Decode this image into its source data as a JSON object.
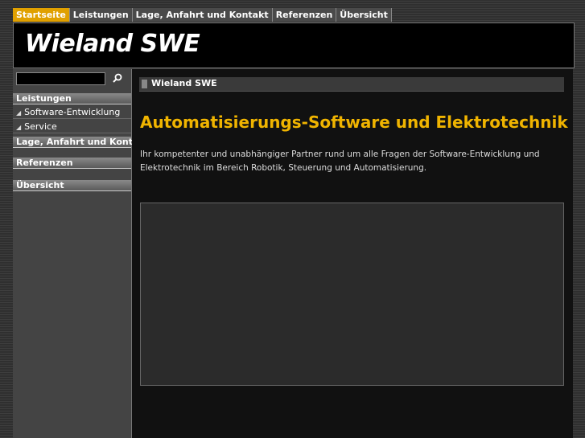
{
  "nav": {
    "tabs": [
      {
        "label": "Startseite",
        "active": true
      },
      {
        "label": "Leistungen",
        "active": false
      },
      {
        "label": "Lage, Anfahrt und Kontakt",
        "active": false
      },
      {
        "label": "Referenzen",
        "active": false
      },
      {
        "label": "Übersicht",
        "active": false
      }
    ]
  },
  "header": {
    "logo": "Wieland SWE"
  },
  "sidebar": {
    "search": {
      "value": "",
      "placeholder": ""
    },
    "sections": [
      {
        "label": "Leistungen"
      },
      {
        "label": "Lage, Anfahrt und Kontakt"
      },
      {
        "label": "Referenzen"
      },
      {
        "label": "Übersicht"
      }
    ],
    "subitems": [
      {
        "label": "Software-Entwicklung"
      },
      {
        "label": "Service"
      }
    ]
  },
  "main": {
    "breadcrumb": "Wieland SWE",
    "heading": "Automatisierungs-Software und Elektrotechnik",
    "paragraph_line1": "Ihr kompetenter und unabhängiger Partner rund um alle Fragen der Software-Entwicklung und",
    "paragraph_line2": "Elektrotechnik im Bereich Robotik, Steuerung und Automatisierung."
  },
  "colors": {
    "accent": "#e0a000",
    "heading": "#f0b400"
  }
}
